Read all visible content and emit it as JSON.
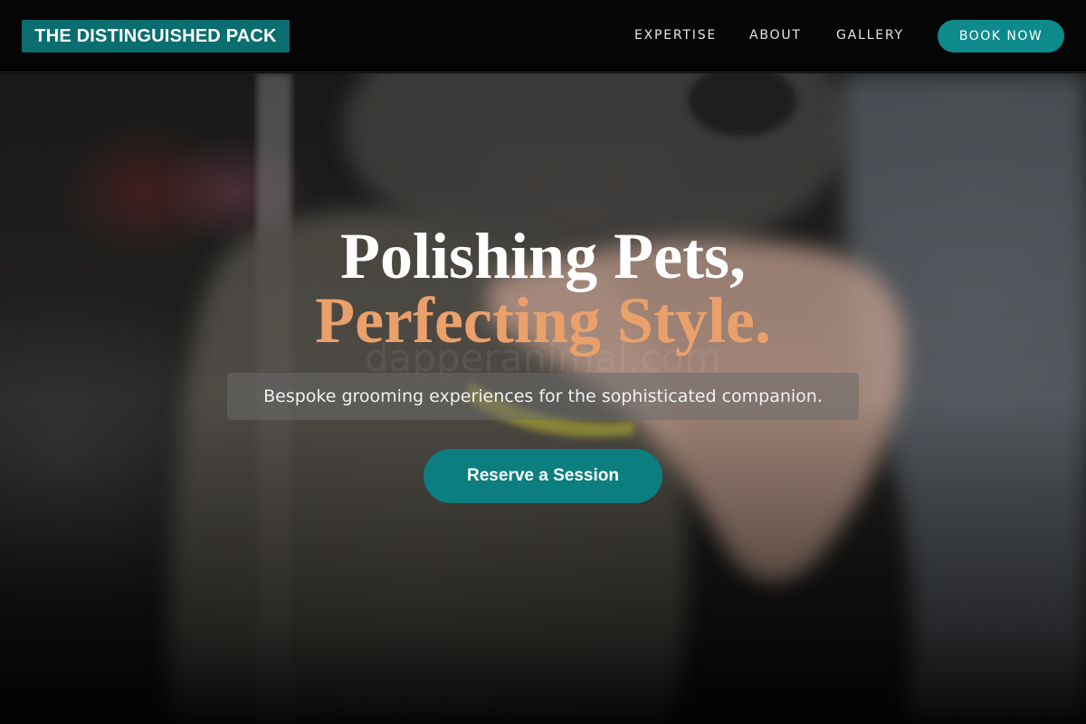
{
  "header": {
    "logo_text": "THE DISTINGUISHED PACK",
    "nav": {
      "expertise": "EXPERTISE",
      "about": "ABOUT",
      "gallery": "GALLERY"
    },
    "book_button": "BOOK NOW"
  },
  "hero": {
    "headline_line1": "Polishing Pets,",
    "headline_line2": "Perfecting Style.",
    "watermark": "dapperanimal.com",
    "subtitle": "Bespoke grooming experiences for the sophisticated companion.",
    "cta_label": "Reserve a Session",
    "background_image": "groomer-holding-poodle-photo"
  },
  "colors": {
    "brand_teal": "#0a6d6f",
    "button_teal": "#0e8a8c",
    "accent_orange": "#eaa06a",
    "header_bg": "#050505"
  }
}
